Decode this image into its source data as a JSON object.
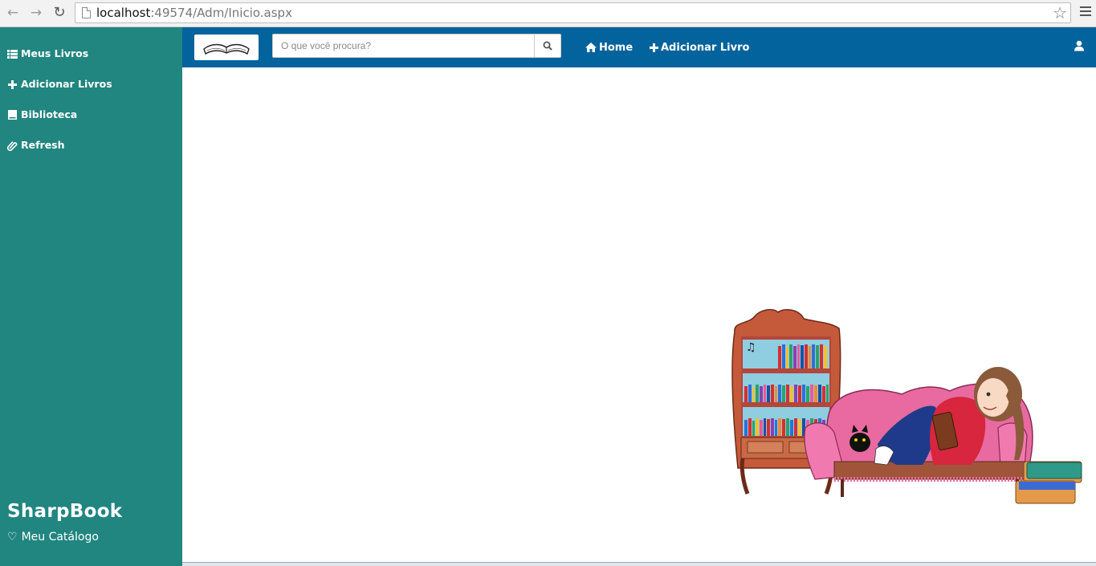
{
  "browser": {
    "url_host": "localhost",
    "url_rest": ":49574/Adm/Inicio.aspx"
  },
  "sidebar": {
    "items": [
      {
        "label": "Meus Livros",
        "icon": "list-icon"
      },
      {
        "label": "Adicionar Livros",
        "icon": "plus-icon"
      },
      {
        "label": "Biblioteca",
        "icon": "book-icon"
      },
      {
        "label": "Refresh",
        "icon": "paperclip-icon"
      }
    ],
    "brand": "SharpBook",
    "brand_sub": "Meu Catálogo"
  },
  "topbar": {
    "search_placeholder": "O que você procura?",
    "links": [
      {
        "label": "Home",
        "icon": "home-icon"
      },
      {
        "label": "Adicionar Livro",
        "icon": "plus-icon"
      }
    ]
  },
  "colors": {
    "sidebar_bg": "#218580",
    "topbar_bg": "#03639c"
  }
}
